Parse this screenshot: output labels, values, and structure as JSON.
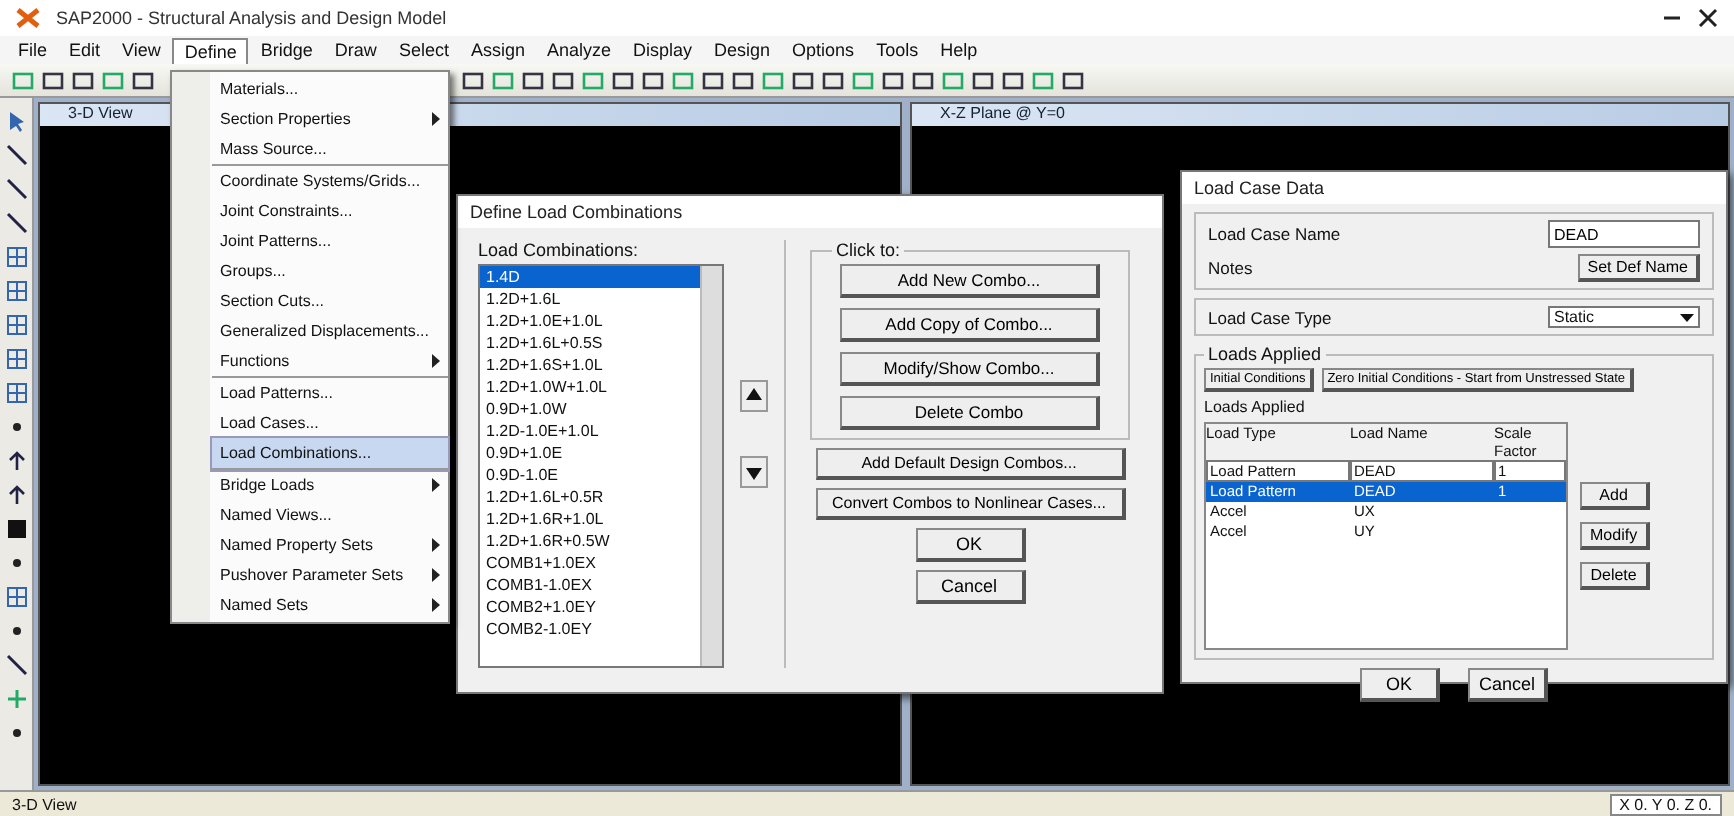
{
  "window": {
    "title": "SAP2000 - Structural Analysis and Design Model"
  },
  "menu_bar": [
    {
      "label": "File",
      "selected": false
    },
    {
      "label": "Edit",
      "selected": false
    },
    {
      "label": "View",
      "selected": false
    },
    {
      "label": "Define",
      "selected": true
    },
    {
      "label": "Bridge",
      "selected": false
    },
    {
      "label": "Draw",
      "selected": false
    },
    {
      "label": "Select",
      "selected": false
    },
    {
      "label": "Assign",
      "selected": false
    },
    {
      "label": "Analyze",
      "selected": false
    },
    {
      "label": "Display",
      "selected": false
    },
    {
      "label": "Design",
      "selected": false
    },
    {
      "label": "Options",
      "selected": false
    },
    {
      "label": "Tools",
      "selected": false
    },
    {
      "label": "Help",
      "selected": false
    }
  ],
  "define_menu": [
    {
      "label": "Materials...",
      "submenu": false,
      "selected": false,
      "separator": false
    },
    {
      "label": "Section Properties",
      "submenu": true,
      "selected": false,
      "separator": false
    },
    {
      "label": "Mass Source...",
      "submenu": false,
      "selected": false,
      "separator": true
    },
    {
      "label": "Coordinate Systems/Grids...",
      "submenu": false,
      "selected": false,
      "separator": false
    },
    {
      "label": "Joint Constraints...",
      "submenu": false,
      "selected": false,
      "separator": false
    },
    {
      "label": "Joint Patterns...",
      "submenu": false,
      "selected": false,
      "separator": false
    },
    {
      "label": "Groups...",
      "submenu": false,
      "selected": false,
      "separator": false
    },
    {
      "label": "Section Cuts...",
      "submenu": false,
      "selected": false,
      "separator": false
    },
    {
      "label": "Generalized Displacements...",
      "submenu": false,
      "selected": false,
      "separator": false
    },
    {
      "label": "Functions",
      "submenu": true,
      "selected": false,
      "separator": true
    },
    {
      "label": "Load Patterns...",
      "submenu": false,
      "selected": false,
      "separator": false
    },
    {
      "label": "Load Cases...",
      "submenu": false,
      "selected": false,
      "separator": false
    },
    {
      "label": "Load Combinations...",
      "submenu": false,
      "selected": true,
      "separator": true
    },
    {
      "label": "Bridge Loads",
      "submenu": true,
      "selected": false,
      "separator": false
    },
    {
      "label": "Named Views...",
      "submenu": false,
      "selected": false,
      "separator": false
    },
    {
      "label": "Named Property Sets",
      "submenu": true,
      "selected": false,
      "separator": false
    },
    {
      "label": "Pushover Parameter Sets",
      "submenu": true,
      "selected": false,
      "separator": false
    },
    {
      "label": "Named Sets",
      "submenu": true,
      "selected": false,
      "separator": false
    }
  ],
  "panes": [
    {
      "title": "3-D View"
    },
    {
      "title": "X-Z Plane @ Y=0"
    }
  ],
  "combinations_dialog": {
    "title": "Define Load Combinations",
    "list_label": "Load Combinations:",
    "combinations": [
      {
        "name": "1.4D",
        "selected": true
      },
      {
        "name": "1.2D+1.6L",
        "selected": false
      },
      {
        "name": "1.2D+1.0E+1.0L",
        "selected": false
      },
      {
        "name": "1.2D+1.6L+0.5S",
        "selected": false
      },
      {
        "name": "1.2D+1.6S+1.0L",
        "selected": false
      },
      {
        "name": "1.2D+1.0W+1.0L",
        "selected": false
      },
      {
        "name": "0.9D+1.0W",
        "selected": false
      },
      {
        "name": "1.2D-1.0E+1.0L",
        "selected": false
      },
      {
        "name": "0.9D+1.0E",
        "selected": false
      },
      {
        "name": "0.9D-1.0E",
        "selected": false
      },
      {
        "name": "1.2D+1.6L+0.5R",
        "selected": false
      },
      {
        "name": "1.2D+1.6R+1.0L",
        "selected": false
      },
      {
        "name": "1.2D+1.6R+0.5W",
        "selected": false
      },
      {
        "name": "COMB1+1.0EX",
        "selected": false
      },
      {
        "name": "COMB1-1.0EX",
        "selected": false
      },
      {
        "name": "COMB2+1.0EY",
        "selected": false
      },
      {
        "name": "COMB2-1.0EY",
        "selected": false
      }
    ],
    "click_label": "Click to:",
    "buttons": [
      "Add New Combo...",
      "Add Copy of Combo...",
      "Modify/Show Combo...",
      "Delete Combo"
    ],
    "extra_buttons": [
      "Add Default Design Combos...",
      "Convert Combos to Nonlinear Cases..."
    ],
    "ok": "OK",
    "cancel": "Cancel"
  },
  "case_dialog": {
    "title": "Load Case Data",
    "name_label": "Load Case Name",
    "name_value": "DEAD",
    "set_name_button": "Set Def Name",
    "notes_label": "Notes",
    "type_label": "Load Case Type",
    "type_value": "Static",
    "group_label": "Loads Applied",
    "tab_buttons": [
      "Initial Conditions",
      "Zero Initial Conditions - Start from Unstressed State"
    ],
    "table_label": "Loads Applied",
    "columns": [
      "Load Type",
      "Load Name",
      "Scale Factor"
    ],
    "entry": [
      "Load Pattern",
      "DEAD",
      "1"
    ],
    "rows": [
      {
        "cells": [
          "Load Pattern",
          "DEAD",
          "1"
        ],
        "selected": true
      },
      {
        "cells": [
          "Accel",
          "UX",
          ""
        ],
        "selected": false
      },
      {
        "cells": [
          "Accel",
          "UY",
          ""
        ],
        "selected": false
      }
    ],
    "side_buttons": [
      "Add",
      "Modify",
      "Delete"
    ],
    "ok": "OK",
    "cancel": "Cancel"
  },
  "status_bar": {
    "text": "3-D View",
    "coords": "X 0.  Y 0.  Z 0."
  }
}
